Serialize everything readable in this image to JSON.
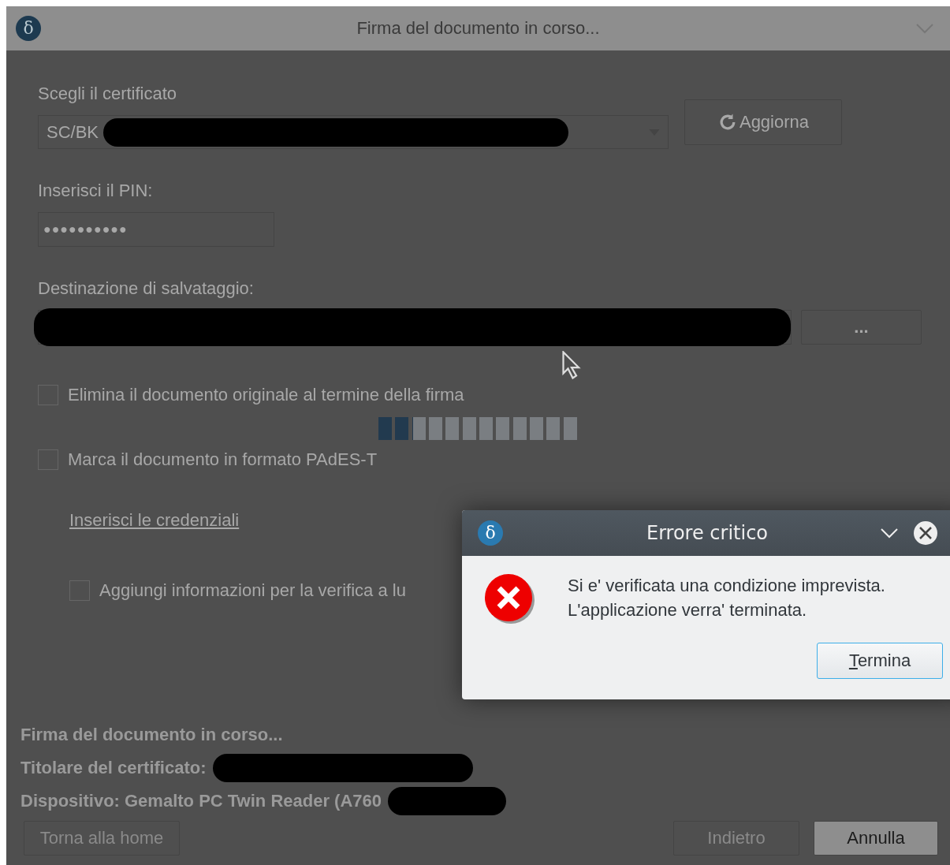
{
  "window": {
    "logo": "δ",
    "title": "Firma del documento in corso..."
  },
  "certificate": {
    "label": "Scegli il certificato",
    "value": "SC/BK",
    "redacted": true,
    "refresh_button": "Aggiorna"
  },
  "pin": {
    "label": "Inserisci il PIN:",
    "value": "●●●●●●●●●●"
  },
  "destination": {
    "label": "Destinazione di salvataggio:",
    "redacted": true,
    "browse_button": "..."
  },
  "options": [
    {
      "label": "Elimina il documento originale al termine della firma",
      "checked": false
    },
    {
      "label": "Marca il documento in formato PAdES-T",
      "checked": false
    }
  ],
  "credentials_link": "Inserisci le credenziali",
  "sub_option": {
    "label": "Aggiungi informazioni per la verifica a lu",
    "checked": false
  },
  "progress": {
    "level": 0.17
  },
  "status_lines": [
    {
      "text": "Firma del documento in corso...",
      "redacted": false
    },
    {
      "text": "Titolare del certificato:",
      "redacted": true
    },
    {
      "text": "Dispositivo: Gemalto PC Twin Reader (A760",
      "redacted": true
    }
  ],
  "footer_buttons": [
    {
      "label": "Torna alla home",
      "disabled": true
    },
    {
      "label": "Indietro",
      "disabled": true
    },
    {
      "label": "Annulla",
      "disabled": false
    }
  ],
  "dialog": {
    "logo": "δ",
    "title": "Errore critico",
    "message": [
      "Si e' verificata una condizione imprevista.",
      "L'applicazione verra' terminata."
    ],
    "button": "Termina"
  }
}
